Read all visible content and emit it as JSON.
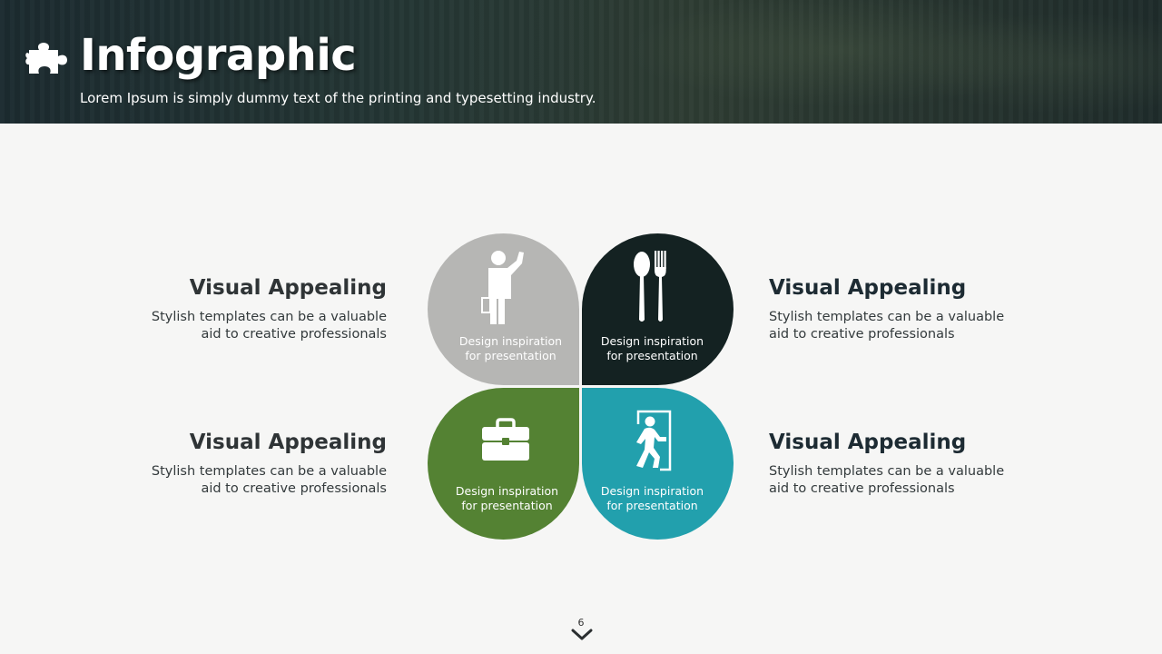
{
  "header": {
    "title": "Infographic",
    "subtitle": "Lorem Ipsum is simply dummy text of the printing and typesetting industry.",
    "icon": "puzzle-piece-icon"
  },
  "left_items": [
    {
      "heading": "Visual Appealing",
      "description": "Stylish templates can be a valuable\naid to  creative professionals"
    },
    {
      "heading": "Visual Appealing",
      "description": "Stylish templates can be a valuable\naid to  creative professionals"
    }
  ],
  "right_items": [
    {
      "heading": "Visual Appealing",
      "description": "Stylish templates can be a valuable\naid to  creative professionals"
    },
    {
      "heading": "Visual Appealing",
      "description": "Stylish templates can be a valuable\naid to  creative professionals"
    }
  ],
  "petals": [
    {
      "caption": "Design inspiration\nfor presentation",
      "icon": "businessman-waving-icon",
      "color": "#b6b6b4"
    },
    {
      "caption": "Design inspiration\nfor presentation",
      "icon": "spoon-fork-icon",
      "color": "#142222"
    },
    {
      "caption": "Design inspiration\nfor presentation",
      "icon": "briefcase-icon",
      "color": "#548233"
    },
    {
      "caption": "Design inspiration\nfor presentation",
      "icon": "exit-door-walking-icon",
      "color": "#22a0ad"
    }
  ],
  "footer": {
    "page_number": "6",
    "nav_icon": "chevron-down-icon"
  }
}
